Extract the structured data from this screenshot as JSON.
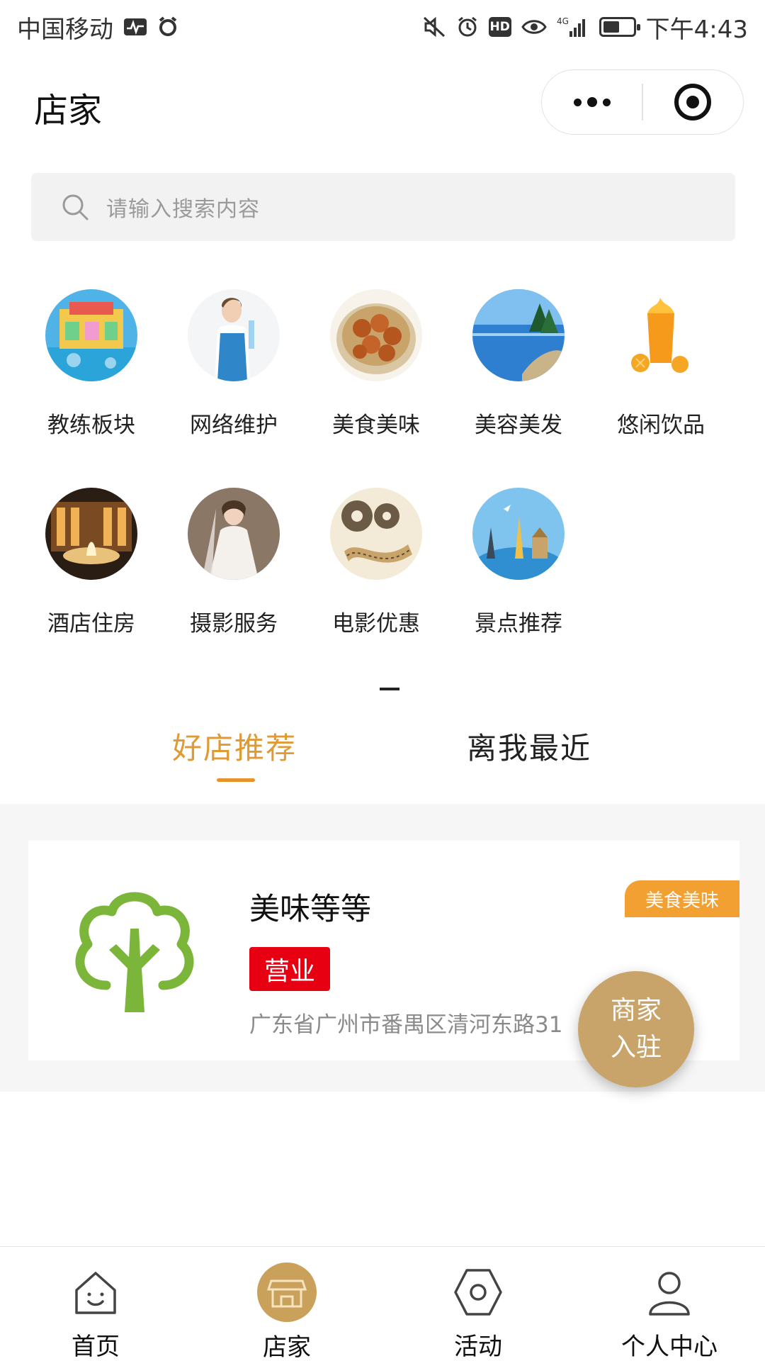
{
  "status_bar": {
    "carrier": "中国移动",
    "hd": "HD",
    "network": "4G",
    "time": "下午4:43"
  },
  "header": {
    "title": "店家"
  },
  "search": {
    "placeholder": "请输入搜索内容"
  },
  "categories": [
    {
      "label": "教练板块",
      "icon": "amusement-ride-image"
    },
    {
      "label": "网络维护",
      "icon": "cleaner-worker-image"
    },
    {
      "label": "美食美味",
      "icon": "meatball-dish-image"
    },
    {
      "label": "美容美发",
      "icon": "lake-landscape-image"
    },
    {
      "label": "悠闲饮品",
      "icon": "orange-juice-image"
    },
    {
      "label": "酒店住房",
      "icon": "hotel-fountain-image"
    },
    {
      "label": "摄影服务",
      "icon": "bride-photo-image"
    },
    {
      "label": "电影优惠",
      "icon": "film-reel-image"
    },
    {
      "label": "景点推荐",
      "icon": "landmark-globe-image"
    }
  ],
  "tabs": [
    {
      "label": "好店推荐",
      "active": true
    },
    {
      "label": "离我最近",
      "active": false
    }
  ],
  "stores": [
    {
      "name": "美味等等",
      "tag": "美食美味",
      "status": "营业",
      "address": "广东省广州市番禺区清河东路31",
      "logo": "tree-logo-icon"
    }
  ],
  "float_button": {
    "line1": "商家",
    "line2": "入驻"
  },
  "tabbar": [
    {
      "label": "首页",
      "icon": "home-icon"
    },
    {
      "label": "店家",
      "icon": "store-icon",
      "active": true
    },
    {
      "label": "活动",
      "icon": "hexagon-icon"
    },
    {
      "label": "个人中心",
      "icon": "user-icon"
    }
  ],
  "colors": {
    "accent": "#e8922b",
    "tag": "#f3a032",
    "status_red": "#e60012",
    "float": "#c9a46a",
    "logo_green": "#7bb63b"
  }
}
